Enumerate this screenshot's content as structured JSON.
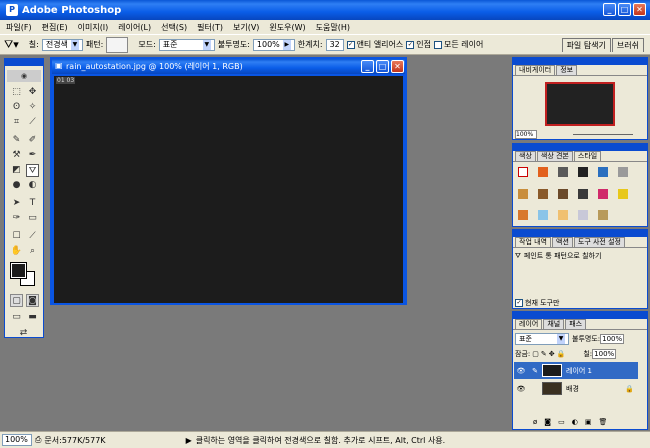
{
  "app": {
    "title": "Adobe Photoshop"
  },
  "menu": [
    "파일(F)",
    "편집(E)",
    "이미지(I)",
    "레이어(L)",
    "선택(S)",
    "필터(T)",
    "보기(V)",
    "윈도우(W)",
    "도움말(H)"
  ],
  "options": {
    "fill_label": "칠:",
    "fill_value": "전경색",
    "pattern_label": "패턴:",
    "mode_label": "모드:",
    "mode_value": "표준",
    "opacity_label": "불투명도:",
    "opacity_value": "100%",
    "tolerance_label": "한계치:",
    "tolerance_value": "32",
    "antialias_label": "앤티 앨리어스",
    "contiguous_label": "인접",
    "all_layers_label": "모든 레이어"
  },
  "well_tabs": [
    "파일 탐색기",
    "브러쉬"
  ],
  "document": {
    "title": "rain_autostation.jpg @ 100% (레이어 1, RGB)",
    "corner_label": "01 03"
  },
  "navigator": {
    "tabs": [
      "내비게이터",
      "정보"
    ],
    "zoom": "100%"
  },
  "styles": {
    "tabs": [
      "색상",
      "색상 견본",
      "스타일"
    ]
  },
  "history": {
    "tabs": [
      "작업 내역",
      "액션",
      "도구 사전 설정"
    ],
    "item": "페인트 통 패턴으로 칠하기",
    "footer": "현재 도구만"
  },
  "layers": {
    "tabs": [
      "레이어",
      "채널",
      "패스"
    ],
    "mode": "표준",
    "opacity_label": "불투명도:",
    "opacity_value": "100%",
    "lock_label": "잠금:",
    "fill_label": "칠:",
    "fill_value": "100%",
    "items": [
      {
        "name": "레이어 1",
        "selected": true
      },
      {
        "name": "배경",
        "selected": false
      }
    ]
  },
  "status": {
    "zoom": "100%",
    "doc": "문서:577K/577K",
    "hint": "클릭하는 영역을 클릭하여 전경색으로 칠함. 추가로 시프트, Alt, Ctrl 사용."
  }
}
